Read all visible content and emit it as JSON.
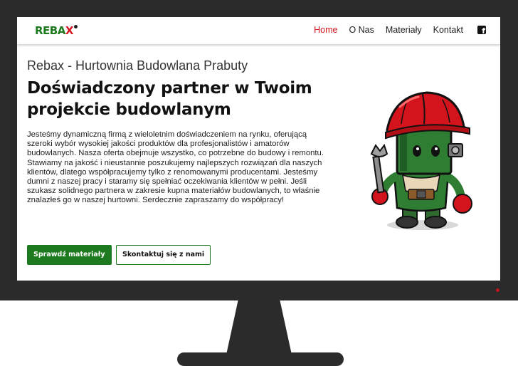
{
  "navbar": {
    "logo_text": "REBA",
    "logo_accent": "X",
    "links": [
      {
        "label": "Home",
        "active": true
      },
      {
        "label": "O Nas",
        "active": false
      },
      {
        "label": "Materiały",
        "active": false
      },
      {
        "label": "Kontakt",
        "active": false
      }
    ],
    "social_icon": "facebook-icon"
  },
  "hero": {
    "subtitle": "Rebax - Hurtownia Budowlana Prabuty",
    "headline": "Doświadczony partner w Twoim projekcie budowlanym",
    "description": "Jesteśmy dynamiczną firmą z wieloletnim doświadczeniem na rynku, oferującą szeroki wybór wysokiej jakości produktów dla profesjonalistów i amatorów budowlanych. Nasza oferta obejmuje wszystko, co potrzebne do budowy i remontu. Stawiamy na jakość i nieustannie poszukujemy najlepszych rozwiązań dla naszych klientów, dlatego współpracujemy tylko z renomowanymi producentami. Jesteśmy dumni z naszej pracy i staramy się spełniać oczekiwania klientów w pełni. Jeśli szukasz solidnego partnera w zakresie kupna materiałów budowlanych, to właśnie znalazłeś go w naszej hurtowni. Serdecznie zapraszamy do współpracy!",
    "primary_button": "Sprawdź materiały",
    "secondary_button": "Skontaktuj się z nami"
  },
  "colors": {
    "brand_green": "#1e7a1e",
    "brand_red": "#d4141c",
    "monitor": "#2b2b2b"
  }
}
